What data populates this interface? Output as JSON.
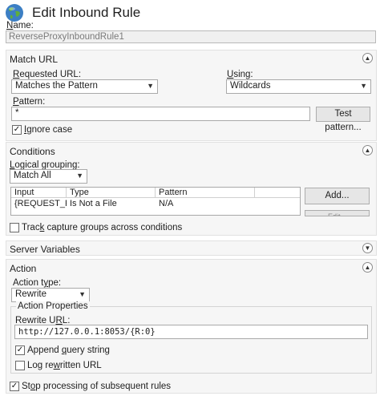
{
  "header": {
    "title": "Edit Inbound Rule",
    "name_label": "Name:",
    "name_value": "ReverseProxyInboundRule1"
  },
  "match_url": {
    "title": "Match URL",
    "requested_url_label": "Requested URL:",
    "requested_url_value": "Matches the Pattern",
    "using_label": "Using:",
    "using_value": "Wildcards",
    "pattern_label": "Pattern:",
    "pattern_value": "*",
    "test_pattern_button": "Test pattern...",
    "ignore_case_label": "Ignore case",
    "ignore_case_checked": true
  },
  "conditions": {
    "title": "Conditions",
    "logical_grouping_label": "Logical grouping:",
    "logical_grouping_value": "Match All",
    "columns": [
      "Input",
      "Type",
      "Pattern"
    ],
    "rows": [
      {
        "input": "{REQUEST_FILE...",
        "type": "Is Not a File",
        "pattern": "N/A"
      }
    ],
    "add_button": "Add...",
    "edit_button": "Edit...",
    "track_capture_label": "Track capture groups across conditions",
    "track_capture_checked": false
  },
  "server_variables": {
    "title": "Server Variables"
  },
  "action": {
    "title": "Action",
    "action_type_label": "Action type:",
    "action_type_value": "Rewrite",
    "properties_title": "Action Properties",
    "rewrite_url_label": "Rewrite URL:",
    "rewrite_url_value": "http://127.0.0.1:8053/{R:0}",
    "append_query_label": "Append query string",
    "append_query_checked": true,
    "log_rewritten_label": "Log rewritten URL",
    "log_rewritten_checked": false,
    "stop_processing_label": "Stop processing of subsequent rules",
    "stop_processing_checked": true
  }
}
